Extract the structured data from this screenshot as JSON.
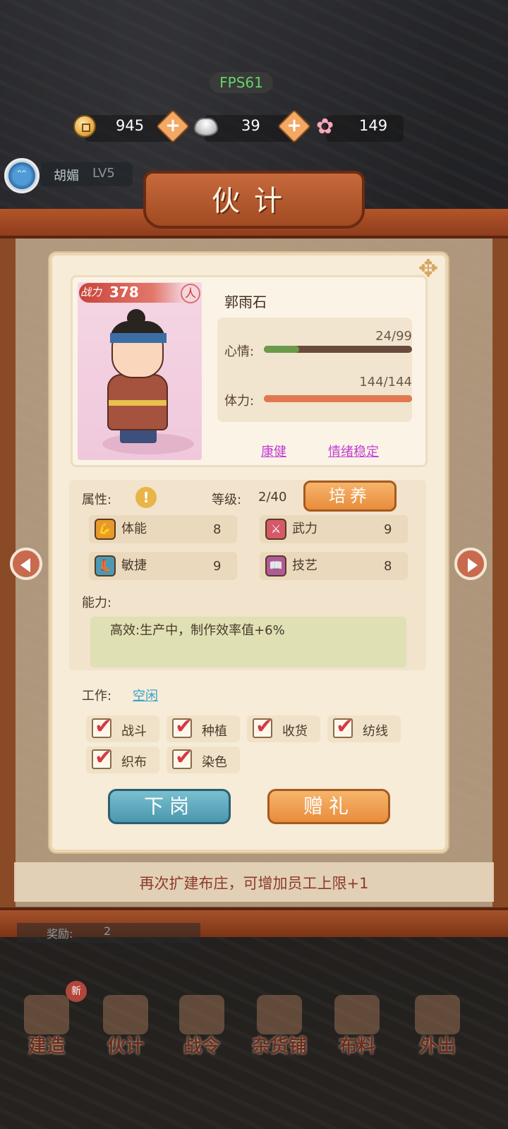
{
  "hud": {
    "fps": "FPS61"
  },
  "currency": {
    "coins": "945",
    "silver": "39",
    "flowers": "149",
    "plus": "+"
  },
  "player": {
    "name": "胡媚",
    "level": "LV5"
  },
  "panel": {
    "title": "伙计"
  },
  "hero": {
    "power_label": "战力",
    "power": "378",
    "rank": "人",
    "name": "郭雨石",
    "mood_label": "心情:",
    "mood_value": "24/99",
    "mood_fraction": 0.24,
    "stamina_label": "体力:",
    "stamina_value": "144/144",
    "stamina_fraction": 1.0,
    "traits": [
      "康健",
      "情绪稳定"
    ]
  },
  "attributes": {
    "label": "属性:",
    "level_label": "等级:",
    "level_value": "2/40",
    "train_button": "培养",
    "items": [
      {
        "name": "体能",
        "value": "8",
        "icon": "arm-icon"
      },
      {
        "name": "武力",
        "value": "9",
        "icon": "sword-icon"
      },
      {
        "name": "敏捷",
        "value": "9",
        "icon": "boot-icon"
      },
      {
        "name": "技艺",
        "value": "8",
        "icon": "book-icon"
      }
    ]
  },
  "ability": {
    "label": "能力:",
    "text": "高效:生产中，制作效率值+6%"
  },
  "work": {
    "label": "工作:",
    "status": "空闲",
    "jobs": [
      "战斗",
      "种植",
      "收货",
      "纺线",
      "织布",
      "染色"
    ]
  },
  "actions": {
    "dismiss": "下岗",
    "gift": "赠礼"
  },
  "expand_tip": "再次扩建布庄，可增加员工上限+1",
  "reward": {
    "label": "奖励:",
    "value": "2"
  },
  "nav": {
    "new_badge": "新",
    "items": [
      "建造",
      "伙计",
      "战令",
      "杂货铺",
      "布料",
      "外出"
    ]
  },
  "colors": {
    "mood_bar": "#6a9a4a",
    "stamina_bar": "#e2784f",
    "accent_orange": "#e98c3c",
    "accent_blue": "#4a97ad",
    "trait_purple": "#c23fd4"
  }
}
